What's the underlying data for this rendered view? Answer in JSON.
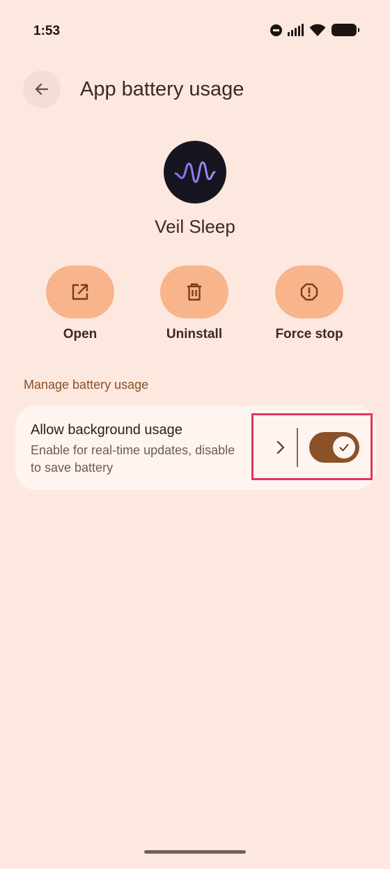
{
  "status_bar": {
    "time": "1:53",
    "icons": [
      "do-not-disturb-icon",
      "signal-icon",
      "wifi-icon",
      "battery-icon"
    ]
  },
  "header": {
    "title": "App battery usage",
    "back_icon": "arrow-left-icon"
  },
  "app": {
    "name": "Veil Sleep",
    "icon": "waveform-icon"
  },
  "actions": [
    {
      "label": "Open",
      "icon": "open-external-icon"
    },
    {
      "label": "Uninstall",
      "icon": "trash-icon"
    },
    {
      "label": "Force stop",
      "icon": "stop-octagon-icon"
    }
  ],
  "section": {
    "header": "Manage battery usage"
  },
  "setting": {
    "title": "Allow background usage",
    "description": "Enable for real-time updates, disable to save battery",
    "toggle_on": true
  },
  "colors": {
    "background": "#fde8e0",
    "card": "#fff4ef",
    "action_pill": "#f8b48a",
    "toggle_track": "#8b5129",
    "section_header": "#8a4f24",
    "highlight": "#e2365f"
  }
}
